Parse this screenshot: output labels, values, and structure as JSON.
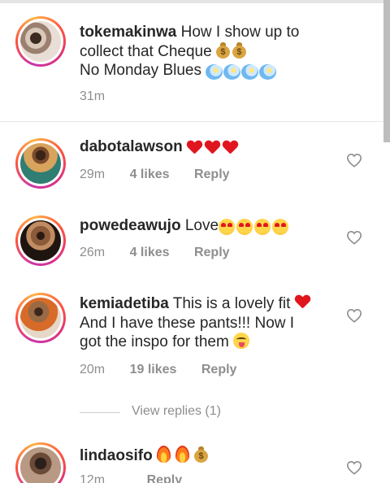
{
  "caption": {
    "username": "tokemakinwa",
    "text_line1": " How I show up to",
    "text_line2": "collect that Cheque",
    "text_line3": "No Monday Blues",
    "time": "31m"
  },
  "comments": [
    {
      "username": "dabotalawson",
      "text": "",
      "time": "29m",
      "likes": "4 likes",
      "reply": "Reply"
    },
    {
      "username": "powedeawujo",
      "text": " Love",
      "time": "26m",
      "likes": "4 likes",
      "reply": "Reply"
    },
    {
      "username": "kemiadetiba",
      "text_line1": " This is a lovely fit",
      "text_line2": "And I have these pants!!! Now I",
      "text_line3": "got the inspo for them",
      "time": "20m",
      "likes": "19 likes",
      "reply": "Reply"
    },
    {
      "username": "lindaosifo",
      "text": "",
      "time": "12m",
      "reply": "Reply"
    }
  ],
  "view_replies": "View replies (1)",
  "icons": [
    "heart-outline-icon",
    "red-heart-emoji",
    "heart-eyes-emoji",
    "money-bag-emoji",
    "dizzy-emoji",
    "fire-emoji",
    "tongue-wink-emoji"
  ],
  "colors": {
    "text": "#262626",
    "meta": "#8e8e8e",
    "heart": "#e0161f"
  }
}
